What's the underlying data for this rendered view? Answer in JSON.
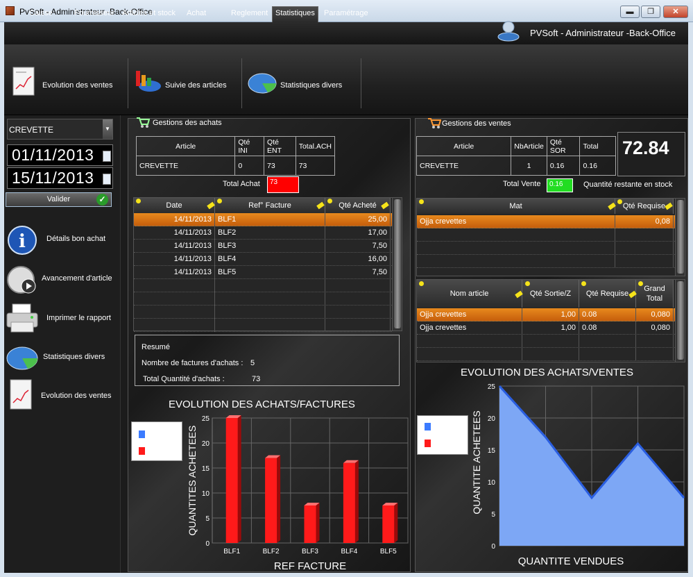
{
  "window": {
    "title": "PvSoft - Administrateur -Back-Office",
    "min": "▬",
    "max": "❐",
    "close": "✕"
  },
  "tabs": [
    "Caisse",
    "Fournisseur",
    "Articles et stock",
    "Achat",
    "Reglement",
    "Statistiques",
    "Paramétrage"
  ],
  "user_title": "PVSoft - Administrateur -Back-Office",
  "ribbon": {
    "evolution": "Evolution des ventes",
    "suivie": "Suivie des articles",
    "stats": "Statistiques divers"
  },
  "sidebar": {
    "article": "CREVETTE",
    "date_from": "01/11/2013",
    "date_to": "15/11/2013",
    "valider": "Valider",
    "items": [
      "Détails bon achat",
      "Avancement d'article",
      "Imprimer le rapport",
      "Statistiques divers",
      "Evolution des ventes"
    ]
  },
  "achats": {
    "title": "Gestions des achats",
    "headers": [
      "Article",
      "Qté INI",
      "Qté ENT",
      "Total.ACH"
    ],
    "row": [
      "CREVETTE",
      "0",
      "73",
      "73"
    ],
    "total_label": "Total Achat",
    "total_value": "73",
    "grid_headers": [
      "Date",
      "Ref° Facture",
      "Qté Acheté"
    ],
    "rows": [
      [
        "14/11/2013",
        "BLF1",
        "25,00"
      ],
      [
        "14/11/2013",
        "BLF2",
        "17,00"
      ],
      [
        "14/11/2013",
        "BLF3",
        "7,50"
      ],
      [
        "14/11/2013",
        "BLF4",
        "16,00"
      ],
      [
        "14/11/2013",
        "BLF5",
        "7,50"
      ]
    ],
    "resume_title": "Resumé",
    "nb_factures_label": "Nombre de factures d'achats :",
    "nb_factures": "5",
    "total_qte_label": "Total Quantité d'achats :",
    "total_qte": "73"
  },
  "ventes": {
    "title": "Gestions des ventes",
    "headers": [
      "Article",
      "NbArticle",
      "Qté SOR",
      "Total"
    ],
    "row": [
      "CREVETTE",
      "1",
      "0.16",
      "0.16"
    ],
    "big_number": "72.84",
    "total_label": "Total Vente",
    "total_value": "0.16",
    "stock_label": "Quantité restante en stock",
    "mat_headers": [
      "Mat",
      "Qté Requise"
    ],
    "mat_rows": [
      [
        "Ojja crevettes",
        "0,08"
      ]
    ],
    "nom_headers": [
      "Nom article",
      "Qté Sortie/Z",
      "Qté Requise",
      "Grand Total"
    ],
    "nom_rows": [
      [
        "Ojja crevettes",
        "1,00",
        "0.08",
        "0,080"
      ],
      [
        "Ojja crevettes",
        "1,00",
        "0.08",
        "0,080"
      ]
    ]
  },
  "chart_data": [
    {
      "type": "bar",
      "title": "EVOLUTION DES ACHATS/FACTURES",
      "xlabel": "REF FACTURE",
      "ylabel": "QUANTITES ACHETEES",
      "categories": [
        "BLF1",
        "BLF2",
        "BLF3",
        "BLF4",
        "BLF5"
      ],
      "values": [
        25,
        17,
        7.5,
        16,
        7.5
      ],
      "ylim": [
        0,
        25
      ],
      "yticks": [
        0,
        5,
        10,
        15,
        20,
        25
      ],
      "color": "#ff1a1a",
      "legend_colors": [
        "#3b7bff",
        "#ff1a1a"
      ]
    },
    {
      "type": "area",
      "title": "EVOLUTION DES ACHATS/VENTES",
      "xlabel": "QUANTITE VENDUES",
      "ylabel": "QUANTITE ACHETEES",
      "x": [
        1,
        2,
        3,
        4,
        5
      ],
      "values": [
        25,
        17,
        7.5,
        16,
        7.5
      ],
      "ylim": [
        0,
        25
      ],
      "yticks": [
        0,
        5,
        10,
        15,
        20,
        25
      ],
      "color": "#7da7f5",
      "legend_colors": [
        "#3b7bff",
        "#ff1a1a"
      ]
    }
  ]
}
